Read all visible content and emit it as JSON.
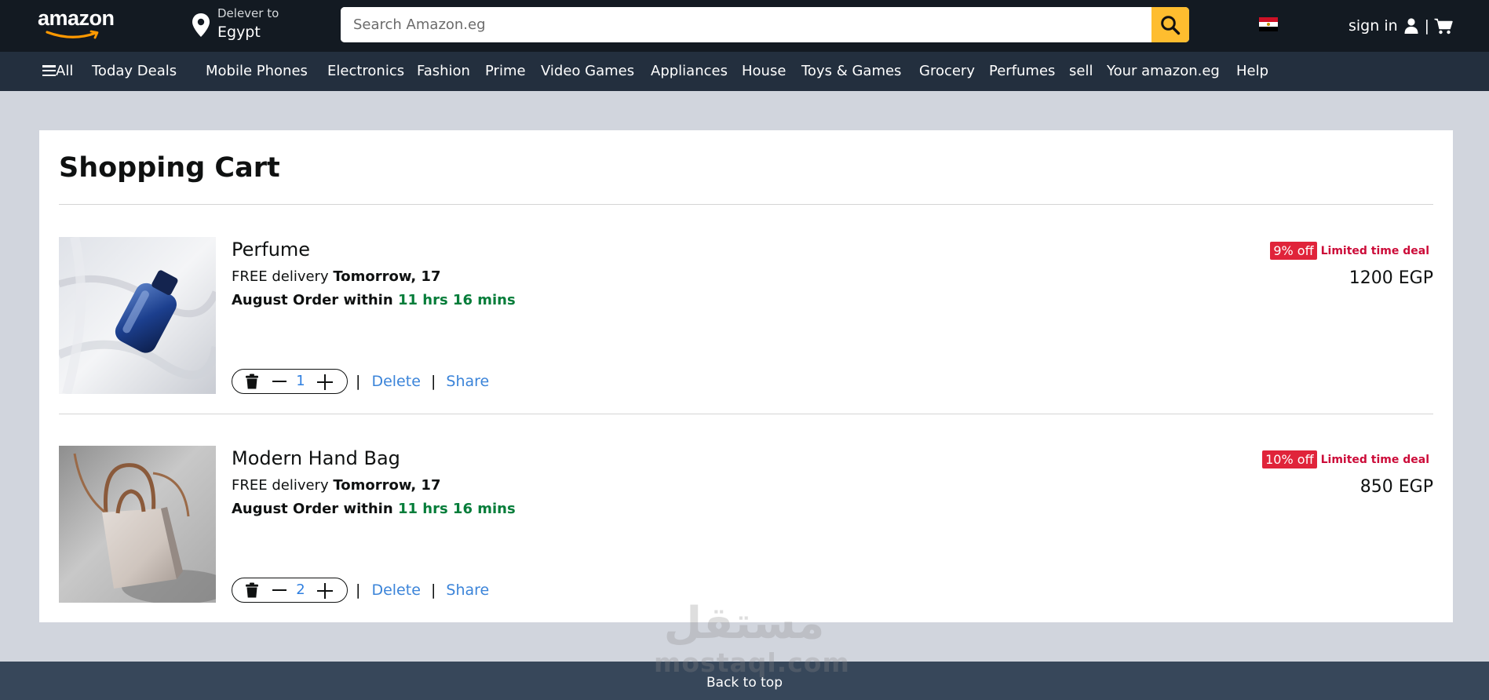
{
  "header": {
    "logo_text": "amazon",
    "deliver_label": "Delever to",
    "deliver_location": "Egypt",
    "search_placeholder": "Search Amazon.eg",
    "sign_in": "sign in",
    "separator": "|",
    "flag_country": "Egypt"
  },
  "nav": {
    "all": "All",
    "items": [
      "Today Deals",
      "Mobile Phones",
      "Electronics",
      "Fashion",
      "Prime",
      "Video Games",
      "Appliances",
      "House",
      "Toys & Games",
      "Grocery",
      "Perfumes",
      "sell",
      "Your amazon.eg",
      "Help"
    ]
  },
  "cart": {
    "title": "Shopping Cart",
    "items": [
      {
        "name": "Perfume",
        "delivery_prefix": "FREE delivery",
        "delivery_date": "Tomorrow, 17",
        "order_prefix": "August Order within",
        "order_time": "11 hrs 16 mins",
        "quantity": "1",
        "delete": "Delete",
        "share": "Share",
        "separator": "|",
        "discount": "9% off",
        "deal_label": "Limited time deal",
        "price": "1200 EGP"
      },
      {
        "name": "Modern Hand Bag",
        "delivery_prefix": "FREE delivery",
        "delivery_date": "Tomorrow, 17",
        "order_prefix": "August Order within",
        "order_time": "11 hrs 16 mins",
        "quantity": "2",
        "delete": "Delete",
        "share": "Share",
        "separator": "|",
        "discount": "10% off",
        "deal_label": "Limited time deal",
        "price": "850 EGP"
      }
    ]
  },
  "footer": {
    "back_to_top": "Back to top"
  },
  "watermark": {
    "arabic": "مستقل",
    "latin": "mostaql.com"
  },
  "colors": {
    "header_bg": "#131a22",
    "nav_bg": "#232f3e",
    "page_bg": "#d1d5dd",
    "search_button": "#febd2f",
    "link": "#3b84d9",
    "deal_badge": "#e0243a",
    "deal_text": "#cc0c39",
    "order_time": "#067d3a",
    "footer_bg": "#37475a"
  },
  "icons": [
    "map-pin-icon",
    "search-icon",
    "egypt-flag-icon",
    "user-icon",
    "cart-icon",
    "menu-icon",
    "trash-icon",
    "minus-icon",
    "plus-icon"
  ]
}
